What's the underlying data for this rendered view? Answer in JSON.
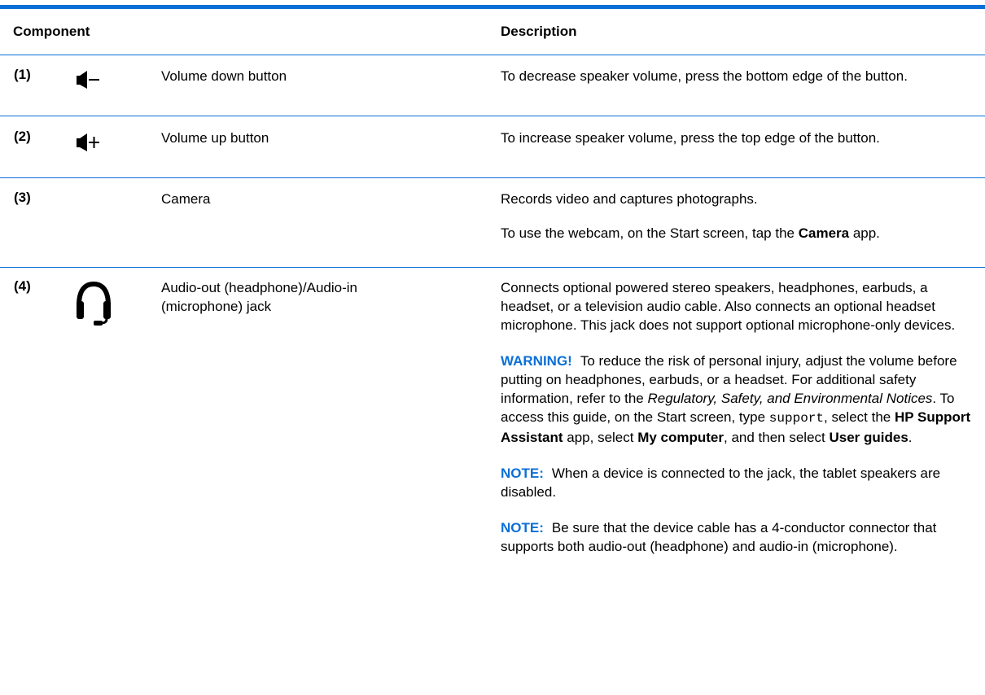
{
  "colors": {
    "accent": "#0b6fd6",
    "text": "#000000"
  },
  "header": {
    "component": "Component",
    "description": "Description"
  },
  "rows": [
    {
      "num": "(1)",
      "icon": "volume-down-icon",
      "name": "Volume down button",
      "desc": "To decrease speaker volume, press the bottom edge of the button."
    },
    {
      "num": "(2)",
      "icon": "volume-up-icon",
      "name": "Volume up button",
      "desc": "To increase speaker volume, press the top edge of the button."
    },
    {
      "num": "(3)",
      "name": "Camera",
      "desc1": "Records video and captures photographs.",
      "desc2": {
        "a": "To use the webcam, on the Start screen, tap the ",
        "b": "Camera",
        "c": " app."
      }
    },
    {
      "num": "(4)",
      "icon": "headset-icon",
      "name": "Audio-out (headphone)/Audio-in (microphone) jack",
      "desc1": "Connects optional powered stereo speakers, headphones, earbuds, a headset, or a television audio cable. Also connects an optional headset microphone. This jack does not support optional microphone-only devices.",
      "warning": {
        "label": "WARNING!",
        "t1": "To reduce the risk of personal injury, adjust the volume before putting on headphones, earbuds, or a headset. For additional safety information, refer to the ",
        "italic": "Regulatory, Safety, and Environmental Notices",
        "t2": ". To access this guide, on the Start screen, type ",
        "code": "support",
        "t3": ", select the ",
        "b1": "HP Support Assistant",
        "t4": " app, select ",
        "b2": "My computer",
        "t5": ", and then select ",
        "b3": "User guides",
        "t6": "."
      },
      "note1": {
        "label": "NOTE:",
        "text": "When a device is connected to the jack, the tablet speakers are disabled."
      },
      "note2": {
        "label": "NOTE:",
        "text": "Be sure that the device cable has a 4-conductor connector that supports both audio-out (headphone) and audio-in (microphone)."
      }
    }
  ]
}
